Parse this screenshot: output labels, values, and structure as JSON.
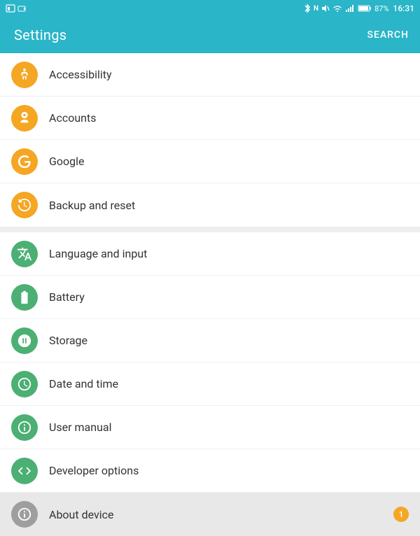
{
  "statusBar": {
    "time": "16:31",
    "battery": "87%",
    "icons": "bluetooth wifi signal"
  },
  "header": {
    "title": "Settings",
    "searchLabel": "SEARCH"
  },
  "sections": [
    {
      "id": "section1",
      "items": [
        {
          "id": "accessibility",
          "label": "Accessibility",
          "iconColor": "orange",
          "iconType": "accessibility",
          "badge": null
        },
        {
          "id": "accounts",
          "label": "Accounts",
          "iconColor": "orange",
          "iconType": "accounts",
          "badge": null
        },
        {
          "id": "google",
          "label": "Google",
          "iconColor": "orange",
          "iconType": "google",
          "badge": null
        },
        {
          "id": "backup",
          "label": "Backup and reset",
          "iconColor": "orange",
          "iconType": "backup",
          "badge": null
        }
      ]
    },
    {
      "id": "section2",
      "items": [
        {
          "id": "language",
          "label": "Language and input",
          "iconColor": "green",
          "iconType": "language",
          "badge": null
        },
        {
          "id": "battery",
          "label": "Battery",
          "iconColor": "green",
          "iconType": "battery",
          "badge": null
        },
        {
          "id": "storage",
          "label": "Storage",
          "iconColor": "green",
          "iconType": "storage",
          "badge": null
        },
        {
          "id": "datetime",
          "label": "Date and time",
          "iconColor": "green",
          "iconType": "datetime",
          "badge": null
        },
        {
          "id": "manual",
          "label": "User manual",
          "iconColor": "green",
          "iconType": "manual",
          "badge": null
        },
        {
          "id": "developer",
          "label": "Developer options",
          "iconColor": "green",
          "iconType": "developer",
          "badge": null
        },
        {
          "id": "about",
          "label": "About device",
          "iconColor": "gray",
          "iconType": "about",
          "badge": "1",
          "highlighted": true
        }
      ]
    }
  ]
}
